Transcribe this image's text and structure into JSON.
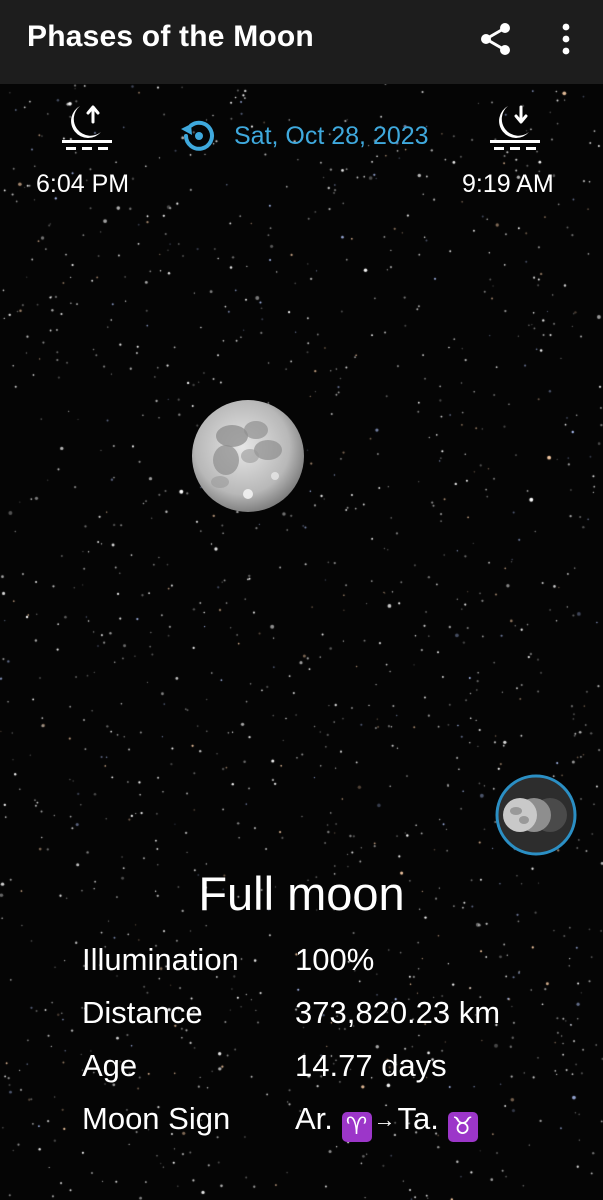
{
  "app_bar": {
    "title": "Phases of the Moon",
    "share_icon": "share-icon",
    "more_icon": "more-vert-icon"
  },
  "moonrise": {
    "icon": "moonrise-icon",
    "time": "6:04 PM"
  },
  "moonset": {
    "icon": "moonset-icon",
    "time": "9:19 AM"
  },
  "date": {
    "icon": "reset-date-icon",
    "text": "Sat, Oct 28, 2023"
  },
  "moon_image": "full-moon",
  "phase_selector_icon": "moon-phases-icon",
  "phase": "Full moon",
  "details": [
    {
      "label": "Illumination",
      "value": "100%"
    },
    {
      "label": "Distance",
      "value": "373,820.23 km"
    },
    {
      "label": "Age",
      "value": "14.77 days"
    }
  ],
  "moon_sign": {
    "label": "Moon Sign",
    "from": "Ar.",
    "from_symbol": "♈",
    "arrow": "→",
    "to": "Ta.",
    "to_symbol": "♉"
  },
  "colors": {
    "accent": "#3fa9dd",
    "app_bar": "#1d1d1d",
    "background": "#050505",
    "zodiac_badge": "#9c36c9"
  }
}
